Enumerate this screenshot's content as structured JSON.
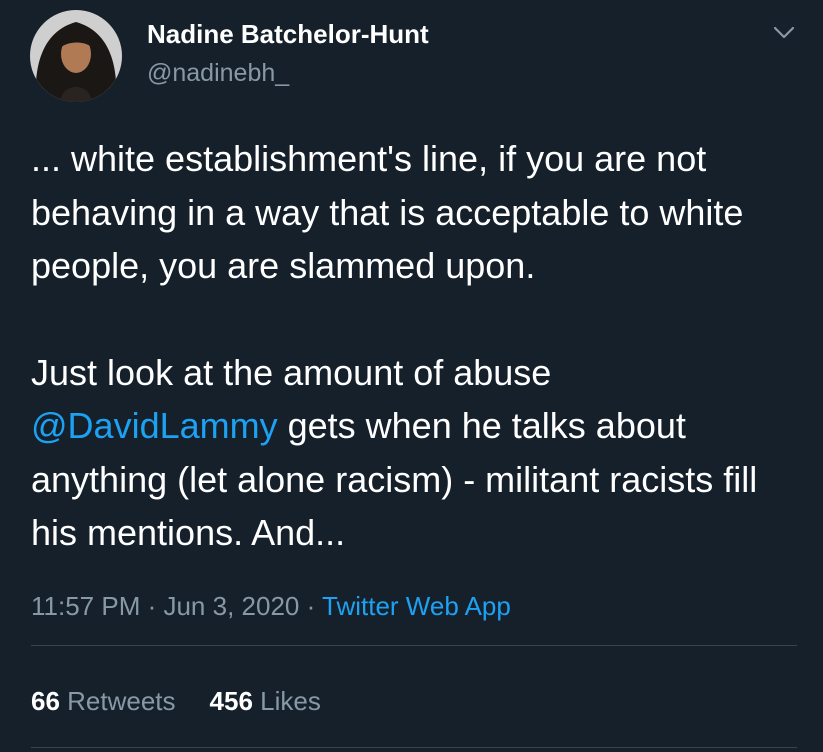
{
  "author": {
    "display_name": "Nadine Batchelor-Hunt",
    "handle": "@nadinebh_"
  },
  "tweet": {
    "line1": "... white establishment's line, if you are not behaving in a way that is acceptable to white people, you are slammed upon.",
    "line2_mention": "@DavidLammy",
    "line2_rest": " gets when he talks about anything (let alone racism) - militant racists fill his mentions. And...",
    "line2_prefix": "Just look at the amount of abuse "
  },
  "meta": {
    "time": "11:57 PM",
    "separator1": " · ",
    "date": "Jun 3, 2020",
    "separator2": " · ",
    "source": "Twitter Web App"
  },
  "stats": {
    "retweets_count": "66",
    "retweets_label": " Retweets",
    "likes_count": "456",
    "likes_label": " Likes"
  },
  "icons": {
    "more": "chevron-down-icon"
  },
  "colors": {
    "background": "#15202b",
    "link": "#1da1f2",
    "secondary_text": "#8899a6",
    "divider": "#38444d"
  }
}
